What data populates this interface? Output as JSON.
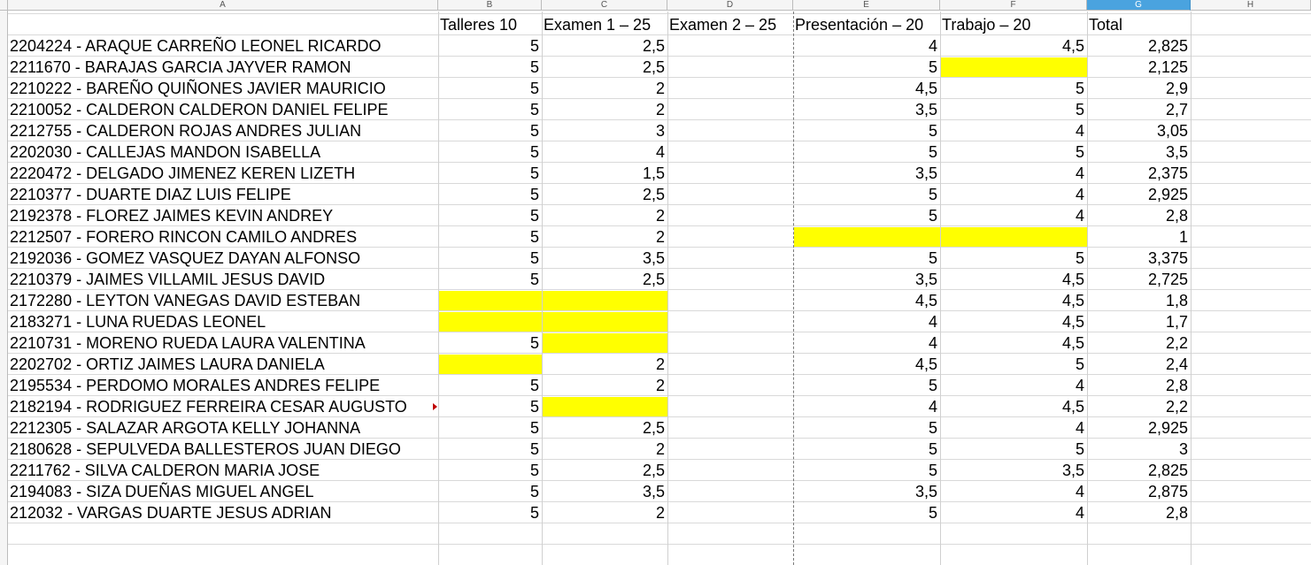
{
  "sheet": {
    "column_headers": [
      "A",
      "B",
      "C",
      "D",
      "E",
      "F",
      "G",
      "H"
    ],
    "selected_column": "G",
    "header_row": [
      "",
      "Talleres 10",
      "Examen 1 – 25",
      "Examen 2 – 25",
      "Presentación – 20",
      "Trabajo – 20",
      "Total"
    ],
    "rows": [
      {
        "name": "2204224 - ARAQUE CARREÑO LEONEL RICARDO",
        "b": "5",
        "c": "2,5",
        "d": "",
        "e": "4",
        "f": "4,5",
        "g": "2,825"
      },
      {
        "name": "2211670 - BARAJAS GARCIA JAYVER RAMON",
        "b": "5",
        "c": "2,5",
        "d": "",
        "e": "5",
        "f": "",
        "g": "2,125"
      },
      {
        "name": "2210222 - BAREÑO QUIÑONES JAVIER MAURICIO",
        "b": "5",
        "c": "2",
        "d": "",
        "e": "4,5",
        "f": "5",
        "g": "2,9"
      },
      {
        "name": "2210052 - CALDERON CALDERON DANIEL FELIPE",
        "b": "5",
        "c": "2",
        "d": "",
        "e": "3,5",
        "f": "5",
        "g": "2,7"
      },
      {
        "name": "2212755 - CALDERON ROJAS ANDRES JULIAN",
        "b": "5",
        "c": "3",
        "d": "",
        "e": "5",
        "f": "4",
        "g": "3,05"
      },
      {
        "name": "2202030 - CALLEJAS MANDON ISABELLA",
        "b": "5",
        "c": "4",
        "d": "",
        "e": "5",
        "f": "5",
        "g": "3,5"
      },
      {
        "name": "2220472 - DELGADO JIMENEZ KEREN LIZETH",
        "b": "5",
        "c": "1,5",
        "d": "",
        "e": "3,5",
        "f": "4",
        "g": "2,375"
      },
      {
        "name": "2210377 - DUARTE DIAZ LUIS FELIPE",
        "b": "5",
        "c": "2,5",
        "d": "",
        "e": "5",
        "f": "4",
        "g": "2,925"
      },
      {
        "name": "2192378 - FLOREZ JAIMES KEVIN ANDREY",
        "b": "5",
        "c": "2",
        "d": "",
        "e": "5",
        "f": "4",
        "g": "2,8"
      },
      {
        "name": "2212507 - FORERO RINCON CAMILO ANDRES",
        "b": "5",
        "c": "2",
        "d": "",
        "e": "",
        "f": "",
        "g": "1"
      },
      {
        "name": "2192036 - GOMEZ VASQUEZ DAYAN ALFONSO",
        "b": "5",
        "c": "3,5",
        "d": "",
        "e": "5",
        "f": "5",
        "g": "3,375"
      },
      {
        "name": "2210379 - JAIMES VILLAMIL JESUS DAVID",
        "b": "5",
        "c": "2,5",
        "d": "",
        "e": "3,5",
        "f": "4,5",
        "g": "2,725"
      },
      {
        "name": "2172280 - LEYTON VANEGAS DAVID ESTEBAN",
        "b": "",
        "c": "",
        "d": "",
        "e": "4,5",
        "f": "4,5",
        "g": "1,8"
      },
      {
        "name": "2183271 - LUNA RUEDAS LEONEL",
        "b": "",
        "c": "",
        "d": "",
        "e": "4",
        "f": "4,5",
        "g": "1,7"
      },
      {
        "name": "2210731 - MORENO RUEDA LAURA VALENTINA",
        "b": "5",
        "c": "",
        "d": "",
        "e": "4",
        "f": "4,5",
        "g": "2,2"
      },
      {
        "name": "2202702 - ORTIZ JAIMES LAURA DANIELA",
        "b": "",
        "c": "2",
        "d": "",
        "e": "4,5",
        "f": "5",
        "g": "2,4"
      },
      {
        "name": "2195534 - PERDOMO MORALES ANDRES FELIPE",
        "b": "5",
        "c": "2",
        "d": "",
        "e": "5",
        "f": "4",
        "g": "2,8"
      },
      {
        "name": "2182194 - RODRIGUEZ FERREIRA CESAR AUGUSTO",
        "b": "5",
        "c": "",
        "d": "",
        "e": "4",
        "f": "4,5",
        "g": "2,2"
      },
      {
        "name": "2212305 - SALAZAR ARGOTA KELLY JOHANNA",
        "b": "5",
        "c": "2,5",
        "d": "",
        "e": "5",
        "f": "4",
        "g": "2,925"
      },
      {
        "name": "2180628 - SEPULVEDA BALLESTEROS JUAN DIEGO",
        "b": "5",
        "c": "2",
        "d": "",
        "e": "5",
        "f": "5",
        "g": "3"
      },
      {
        "name": "2211762 - SILVA CALDERON MARIA JOSE",
        "b": "5",
        "c": "2,5",
        "d": "",
        "e": "5",
        "f": "3,5",
        "g": "2,825"
      },
      {
        "name": "2194083 - SIZA DUEÑAS MIGUEL ANGEL",
        "b": "5",
        "c": "3,5",
        "d": "",
        "e": "3,5",
        "f": "4",
        "g": "2,875"
      },
      {
        "name": "212032 - VARGAS DUARTE JESUS ADRIAN",
        "b": "5",
        "c": "2",
        "d": "",
        "e": "5",
        "f": "4",
        "g": "2,8"
      }
    ],
    "highlight_color": "#ffff00",
    "highlighted_cells": [
      "F3",
      "E11",
      "F11",
      "B14",
      "C14",
      "B15",
      "C15",
      "C16",
      "B17",
      "C19"
    ]
  }
}
